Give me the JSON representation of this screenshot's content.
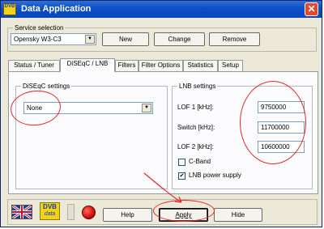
{
  "window": {
    "title": "Data Application",
    "icon_text": "DVB",
    "close_glyph": "✕"
  },
  "service": {
    "group_label": "Service selection",
    "selected": "Opensky W3-C3",
    "new_label": "New",
    "change_label": "Change",
    "remove_label": "Remove"
  },
  "tabs": [
    {
      "label": "Status / Tuner"
    },
    {
      "label": "DiSEqC / LNB"
    },
    {
      "label": "Filters"
    },
    {
      "label": "Filter Options"
    },
    {
      "label": "Statistics"
    },
    {
      "label": "Setup"
    }
  ],
  "diseqc": {
    "group_label": "DiSEqC settings",
    "selected": "None"
  },
  "lnb": {
    "group_label": "LNB settings",
    "lof1_label": "LOF 1 [kHz]:",
    "lof1_value": "9750000",
    "switch_label": "Switch [kHz]:",
    "switch_value": "11700000",
    "lof2_label": "LOF 2 [kHz]:",
    "lof2_value": "10600000",
    "cband_label": "C-Band",
    "cband_checked": false,
    "power_label": "LNB power supply",
    "power_checked": true,
    "check_glyph": "✔"
  },
  "footer": {
    "dvb_logo_line1": "DVB",
    "dvb_logo_line2": "data",
    "help_label": "Help",
    "apply_label": "Apply",
    "hide_label": "Hide"
  },
  "colors": {
    "annotation": "#e12a2a",
    "titlebar": "#0b4fc8"
  }
}
